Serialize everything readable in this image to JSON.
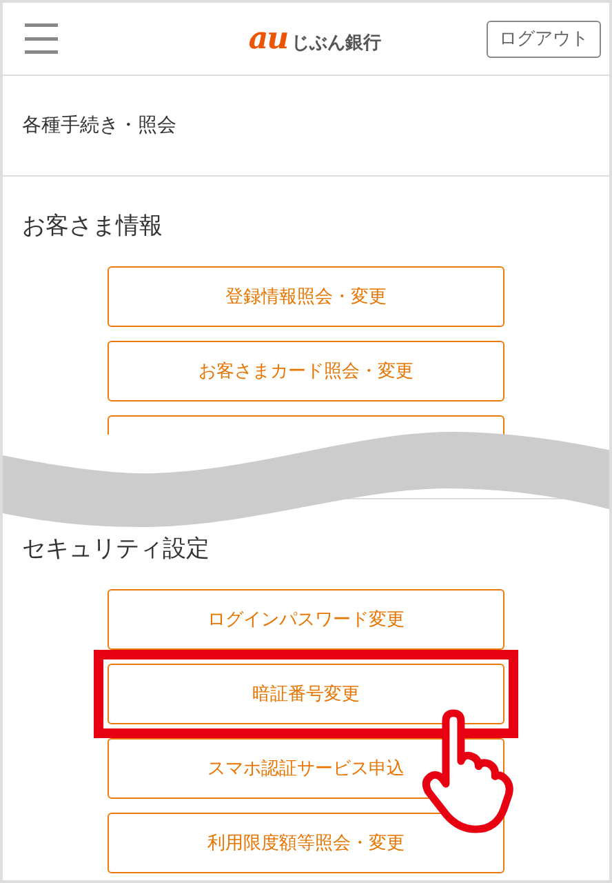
{
  "header": {
    "logo": {
      "mark": "au",
      "name": "じぶん銀行"
    },
    "logout_button": "ログアウト"
  },
  "page_title": "各種手続き・照会",
  "sections": [
    {
      "title": "お客さま情報",
      "buttons": [
        {
          "label": "登録情報照会・変更",
          "highlighted": false
        },
        {
          "label": "お客さまカード照会・変更",
          "highlighted": false
        },
        {
          "highlighted": false
        }
      ]
    },
    {
      "title": "セキュリティ設定",
      "buttons": [
        {
          "label": "ログインパスワード変更",
          "highlighted": false
        },
        {
          "label": "暗証番号変更",
          "highlighted": true
        },
        {
          "label": "スマホ認証サービス申込",
          "highlighted": false
        },
        {
          "label": "利用限度額等照会・変更",
          "highlighted": false
        }
      ]
    }
  ]
}
